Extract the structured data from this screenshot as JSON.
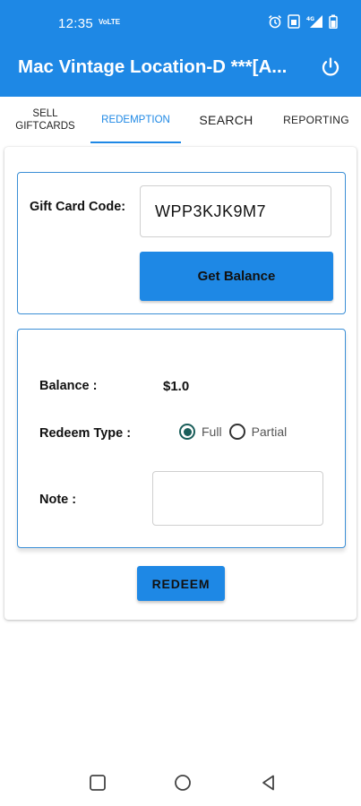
{
  "status_bar": {
    "time": "12:35",
    "volte": "VoLTE",
    "network": "4G"
  },
  "app_bar": {
    "title": "Mac Vintage Location-D ***[A...",
    "power_icon": "power-icon"
  },
  "tabs": [
    {
      "label": "SELL GIFTCARDS",
      "active": false
    },
    {
      "label": "REDEMPTION",
      "active": true
    },
    {
      "label": "SEARCH",
      "active": false
    },
    {
      "label": "REPORTING",
      "active": false
    }
  ],
  "gift_card": {
    "code_label": "Gift Card Code:",
    "code_value": "WPP3KJK9M7",
    "get_balance_label": "Get Balance"
  },
  "details": {
    "balance_label": "Balance :",
    "balance_value": "$1.0",
    "redeem_type_label": "Redeem Type :",
    "options": [
      {
        "label": "Full",
        "selected": true
      },
      {
        "label": "Partial",
        "selected": false
      }
    ],
    "note_label": "Note :",
    "note_value": ""
  },
  "redeem_label": "REDEEM",
  "colors": {
    "primary": "#1e88e5",
    "radio_selected": "#1a5e5a",
    "border": "#3b8fd6"
  }
}
